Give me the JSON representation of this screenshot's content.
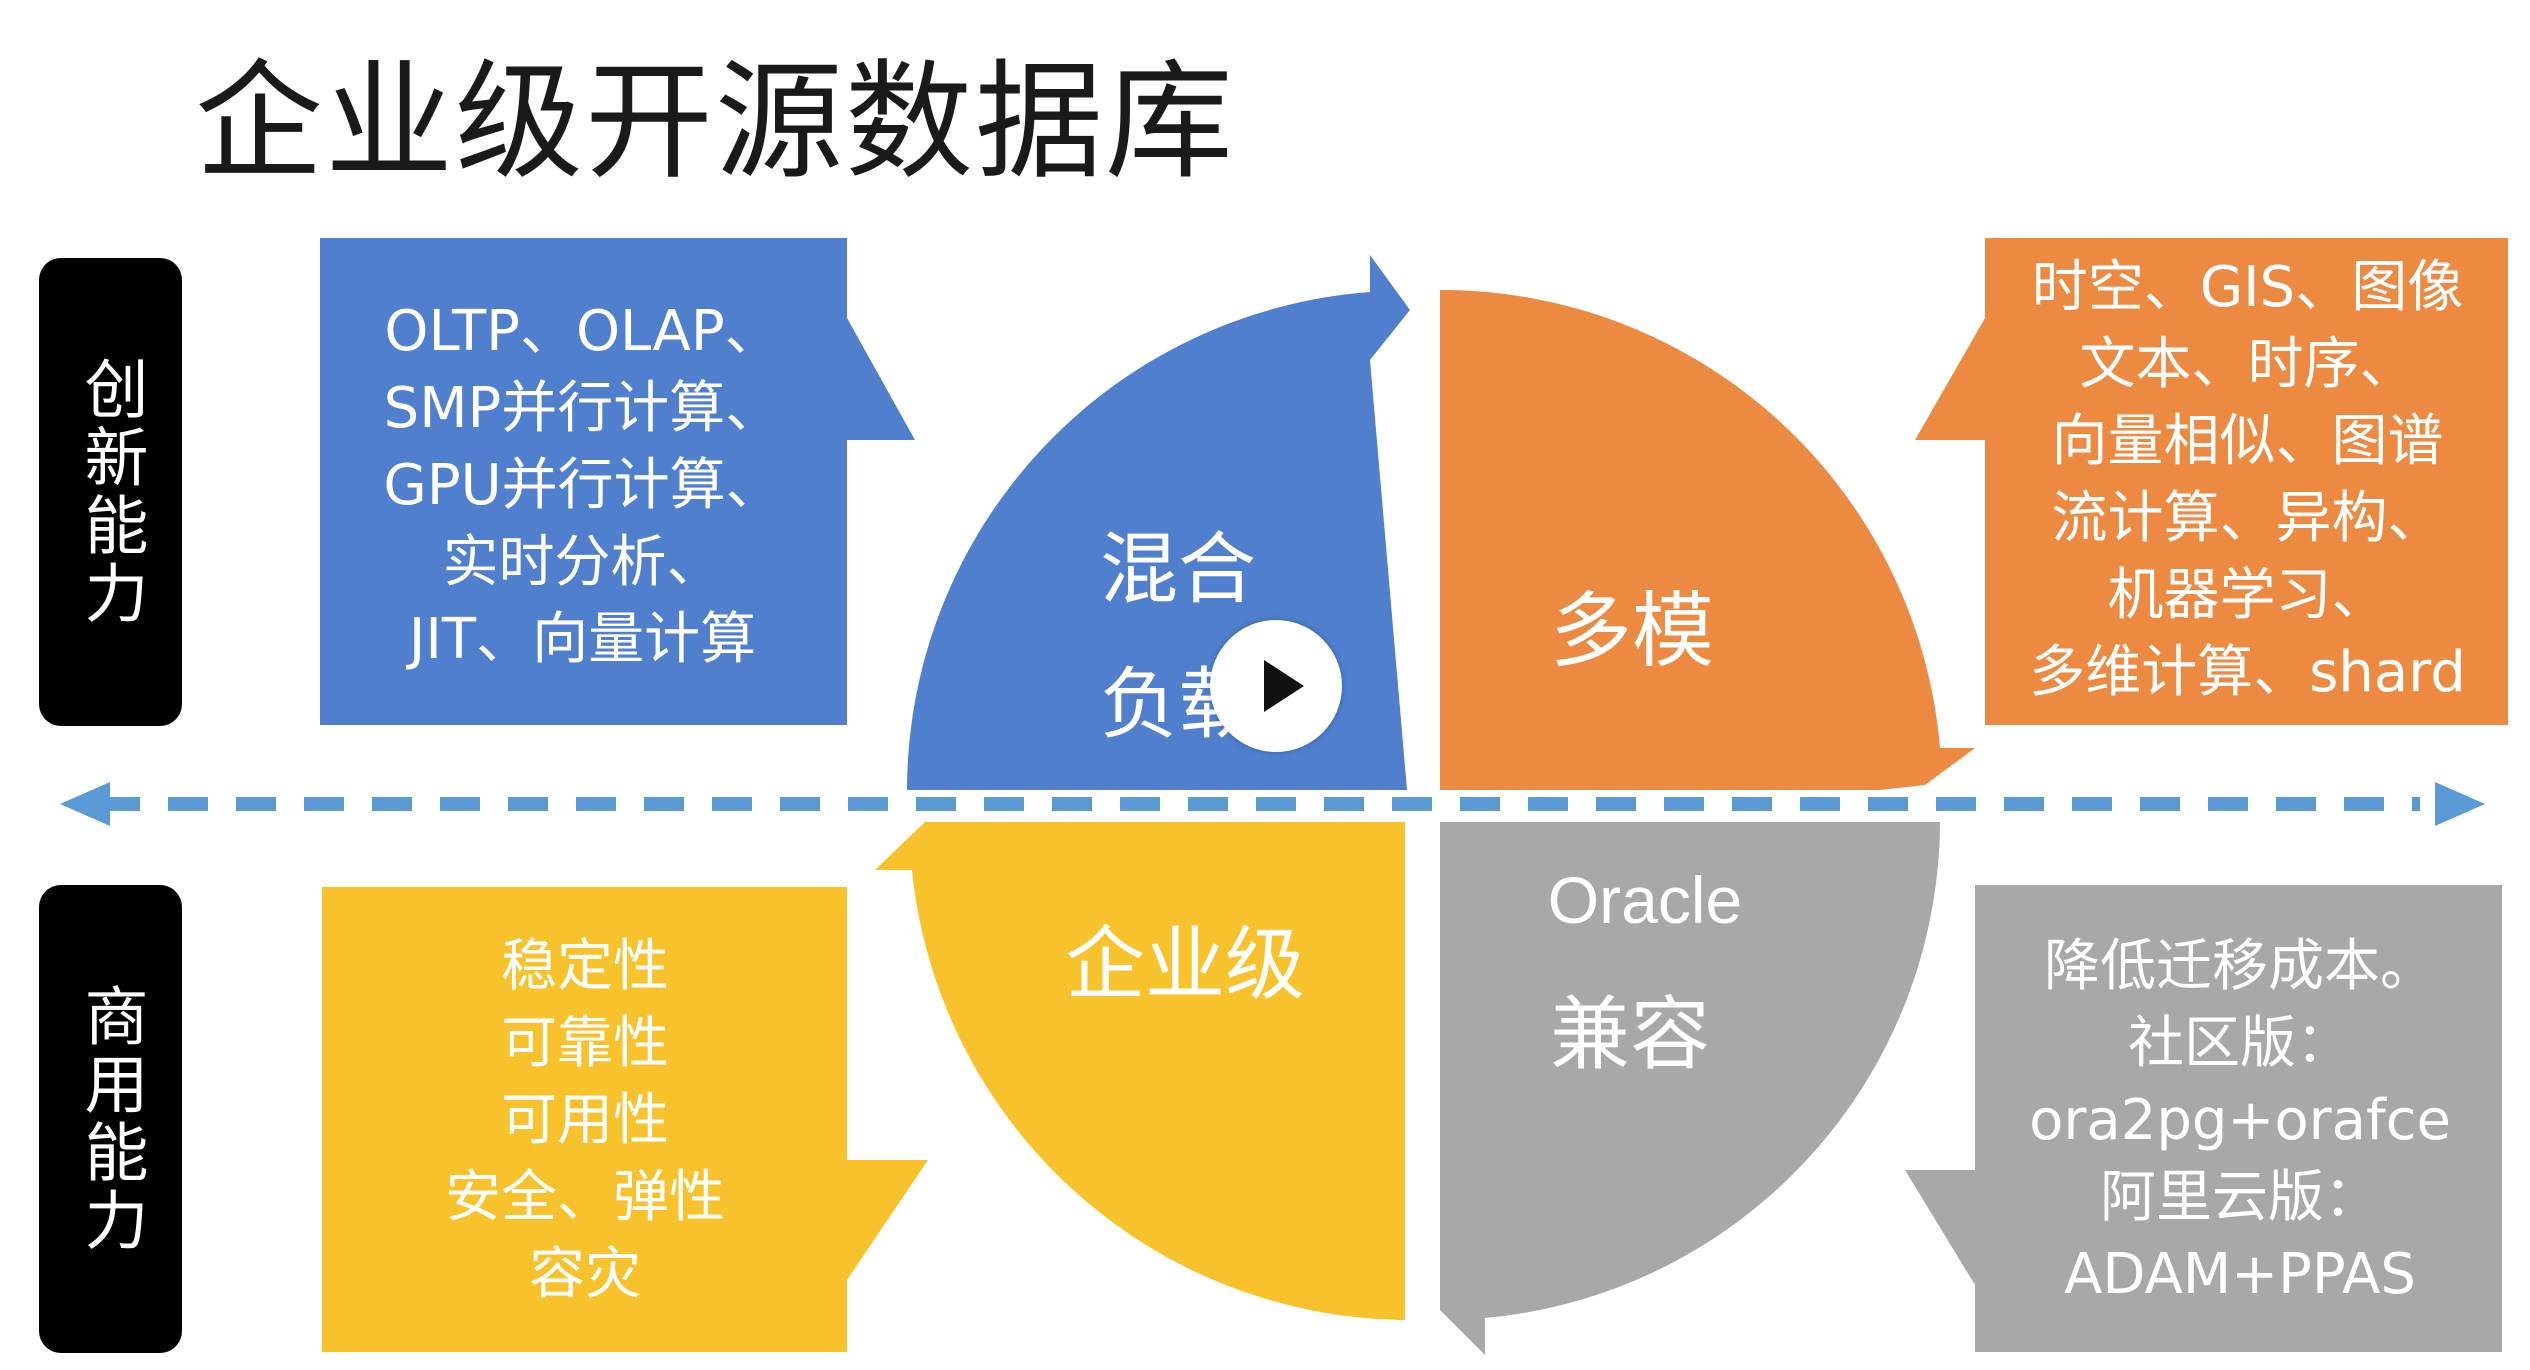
{
  "title": "企业级开源数据库",
  "side_labels": {
    "top": "创新能力",
    "bottom": "商用能力"
  },
  "quadrants": {
    "top_left": {
      "label_line1": "混合",
      "label_line2": "负载"
    },
    "top_right": {
      "label": "多模"
    },
    "bottom_left": {
      "label": "企业级"
    },
    "bottom_right": {
      "label_line1": "Oracle",
      "label_line2": "兼容"
    }
  },
  "callouts": {
    "top_left": [
      "OLTP、OLAP、",
      "SMP并行计算、",
      "GPU并行计算、",
      "实时分析、",
      "JIT、向量计算"
    ],
    "top_right": [
      "时空、GIS、图像",
      "文本、时序、",
      "向量相似、图谱",
      "流计算、异构、",
      "机器学习、",
      "多维计算、shard"
    ],
    "bottom_left": [
      "稳定性",
      "可靠性",
      "可用性",
      "安全、弹性",
      "容灾"
    ],
    "bottom_right": [
      "降低迁移成本。",
      "社区版：",
      "ora2pg+orafce",
      "阿里云版：",
      "ADAM+PPAS"
    ]
  },
  "colors": {
    "blue": "#4f7fcd",
    "orange": "#ec8a41",
    "yellow": "#f8c22d",
    "gray": "#a8a8a8",
    "dash": "#5b9bd5"
  },
  "icons": {
    "play": "play-icon",
    "arrow_left": "arrow-left-icon",
    "arrow_right": "arrow-right-icon"
  }
}
